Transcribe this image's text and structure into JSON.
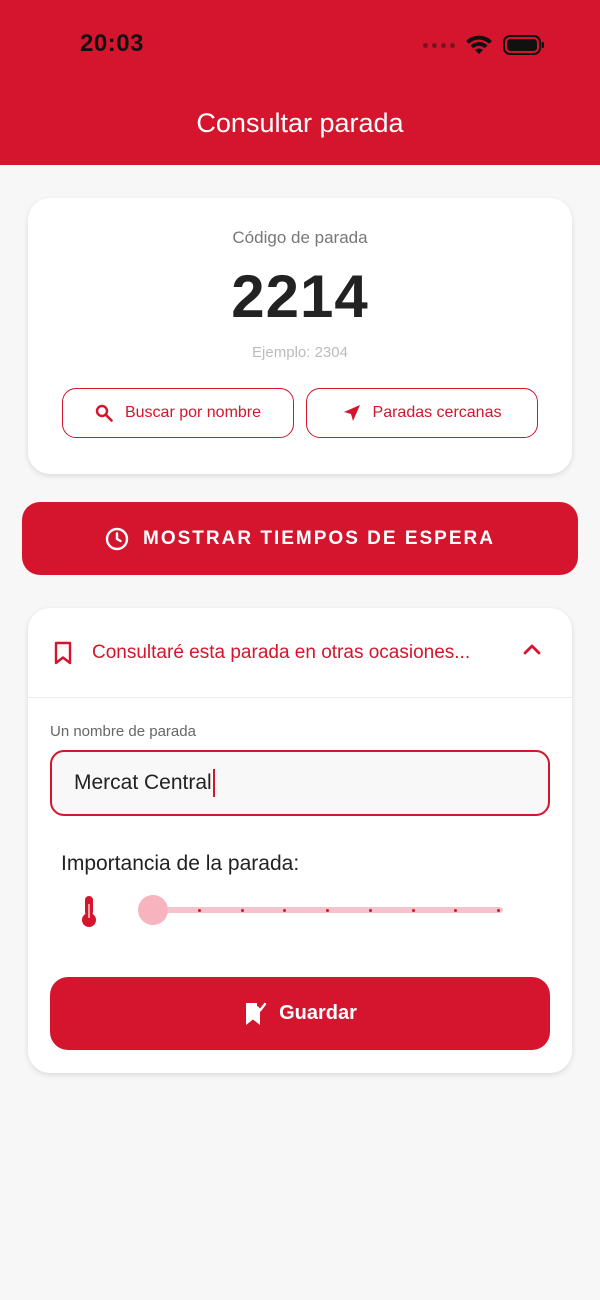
{
  "status_bar": {
    "time": "20:03"
  },
  "header": {
    "title": "Consultar parada"
  },
  "stop_code_card": {
    "label": "Código de parada",
    "code": "2214",
    "example": "Ejemplo: 2304",
    "search_by_name_label": "Buscar por nombre",
    "nearby_stops_label": "Paradas cercanas"
  },
  "show_times_button": {
    "label": "MOSTRAR TIEMPOS DE ESPERA"
  },
  "save_panel": {
    "header": "Consultaré esta parada en otras ocasiones...",
    "name_field": {
      "label": "Un nombre de parada",
      "value": "Mercat Central"
    },
    "importance": {
      "label": "Importancia de la parada:",
      "value": 0,
      "min": 0,
      "max": 8
    },
    "save_label": "Guardar"
  },
  "colors": {
    "accent": "#d4152d",
    "background": "#f7f7f7"
  },
  "icons": [
    "wifi-icon",
    "battery-icon",
    "search-icon",
    "location-arrow-icon",
    "clock-icon",
    "bookmark-icon",
    "chevron-up-icon",
    "thermometer-icon",
    "bookmark-check-icon"
  ]
}
